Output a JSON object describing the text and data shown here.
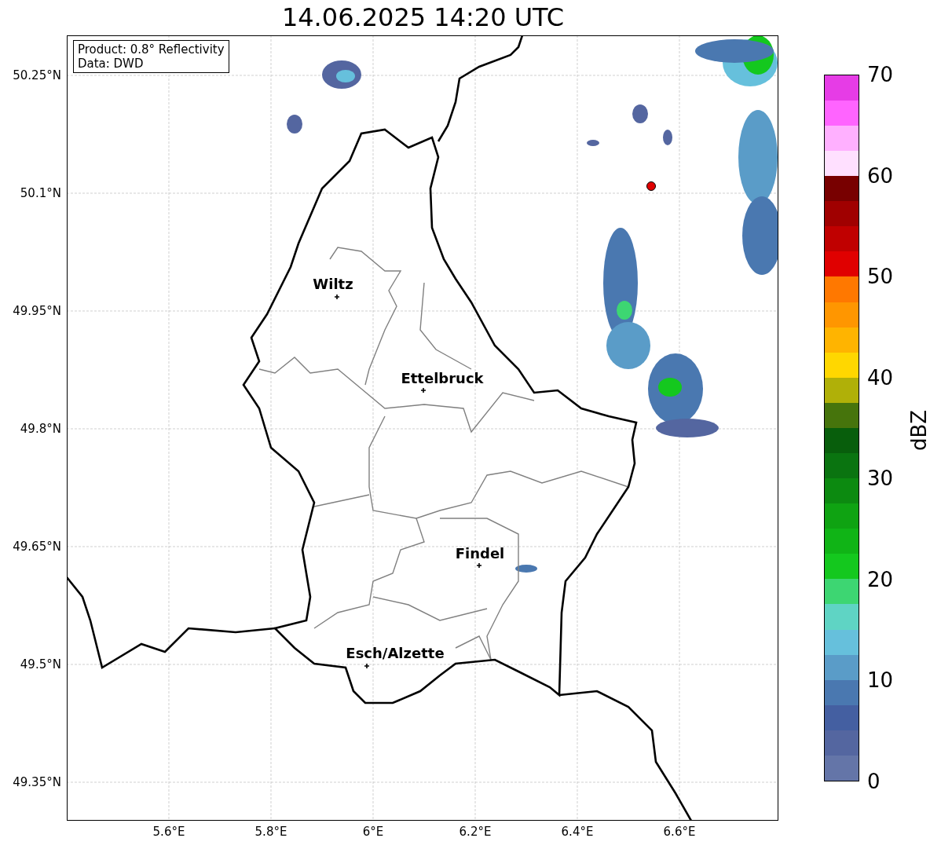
{
  "title": "14.06.2025 14:20 UTC",
  "info_box": [
    "Product: 0.8° Reflectivity",
    "Data: DWD"
  ],
  "map": {
    "lat_ticks": [
      "50.25°N",
      "50.1°N",
      "49.95°N",
      "49.8°N",
      "49.65°N",
      "49.5°N",
      "49.35°N"
    ],
    "lon_ticks": [
      "5.6°E",
      "5.8°E",
      "6°E",
      "6.2°E",
      "6.4°E",
      "6.6°E"
    ],
    "cities": [
      {
        "name": "Wiltz"
      },
      {
        "name": "Ettelbruck"
      },
      {
        "name": "Findel"
      },
      {
        "name": "Esch/Alzette"
      }
    ]
  },
  "colorbar": {
    "label": "dBZ",
    "ticks": [
      "70",
      "60",
      "50",
      "40",
      "30",
      "20",
      "10",
      "0"
    ],
    "segments": [
      {
        "color": "#6475a8"
      },
      {
        "color": "#5466a0"
      },
      {
        "color": "#445fa1"
      },
      {
        "color": "#4a78b0"
      },
      {
        "color": "#5a9cc8"
      },
      {
        "color": "#66c0dc"
      },
      {
        "color": "#5fd4c4"
      },
      {
        "color": "#3dd672"
      },
      {
        "color": "#14c81e"
      },
      {
        "color": "#10b416"
      },
      {
        "color": "#0fa312"
      },
      {
        "color": "#0c8a10"
      },
      {
        "color": "#0a7410"
      },
      {
        "color": "#085e0c"
      },
      {
        "color": "#46740c"
      },
      {
        "color": "#b0b008"
      },
      {
        "color": "#ffd700"
      },
      {
        "color": "#ffb400"
      },
      {
        "color": "#ff9600"
      },
      {
        "color": "#ff7800"
      },
      {
        "color": "#e00000"
      },
      {
        "color": "#c00000"
      },
      {
        "color": "#a00000"
      },
      {
        "color": "#780000"
      },
      {
        "color": "#ffe0ff"
      },
      {
        "color": "#ffb0ff"
      },
      {
        "color": "#ff64ff"
      },
      {
        "color": "#e63ce6"
      }
    ]
  }
}
